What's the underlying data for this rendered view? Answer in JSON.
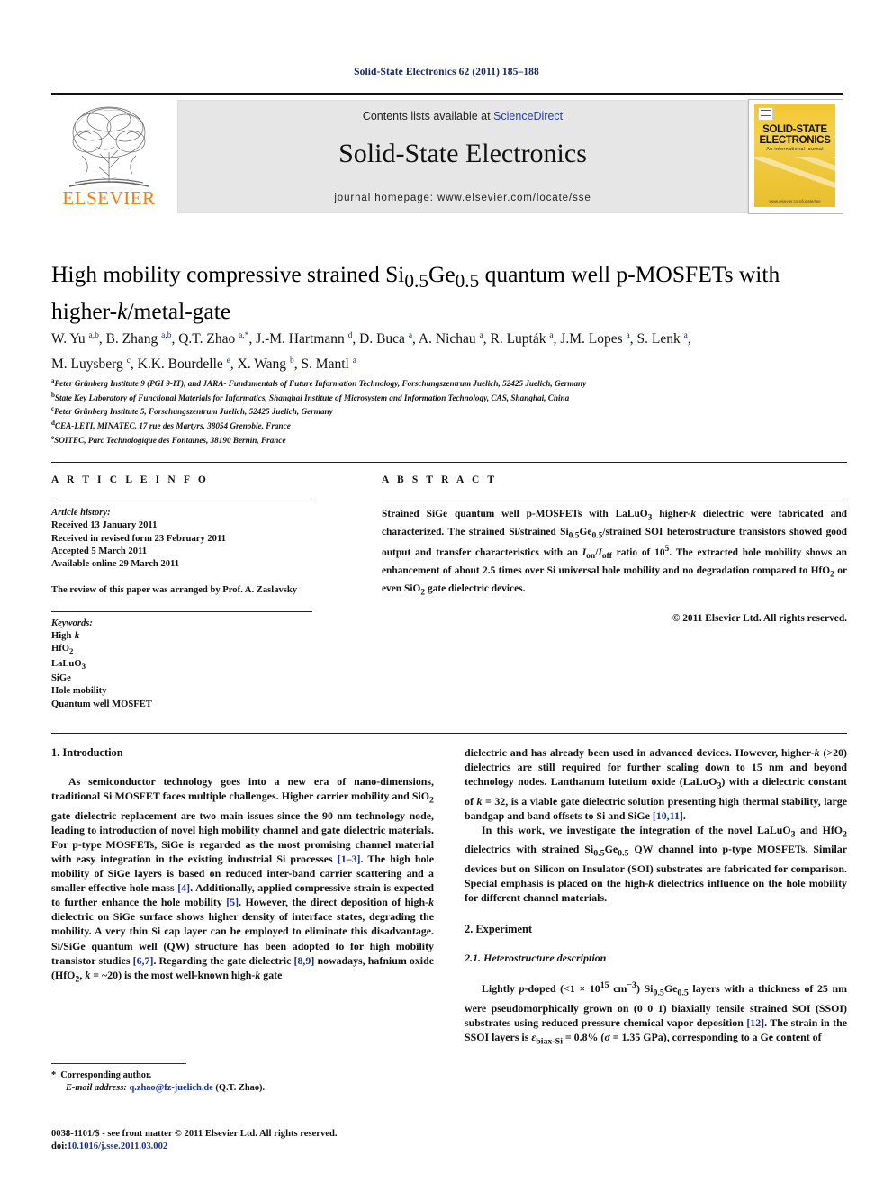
{
  "running_head": "Solid-State Electronics 62 (2011) 185–188",
  "masthead": {
    "contents_prefix": "Contents lists available at ",
    "sciencedirect": "ScienceDirect",
    "journal_title": "Solid-State Electronics",
    "homepage": "journal homepage: www.elsevier.com/locate/sse",
    "publisher": "ELSEVIER",
    "cover": {
      "name_line1": "SOLID-STATE",
      "name_line2": "ELECTRONICS",
      "subtitle": "An international journal",
      "footer": "www.elsevier.com/locate/sse"
    },
    "colors": {
      "link": "#2b3f9e",
      "publisher_orange": "#F07F13",
      "banner_gray": "#e6e6e6",
      "cover_gold": "#f2c733"
    }
  },
  "article": {
    "title_part1": "High mobility compressive strained Si",
    "title_sub1": "0.5",
    "title_part2": "Ge",
    "title_sub2": "0.5",
    "title_part3": " quantum well p-MOSFETs with higher-",
    "title_italic_k": "k",
    "title_part4": "/metal-gate",
    "authors_line1": "W. Yu a,b, B. Zhang a,b, Q.T. Zhao a,*, J.-M. Hartmann d, D. Buca a, A. Nichau a, R. Lupták a, J.M. Lopes a, S. Lenk a,",
    "authors_line2": "M. Luysberg c, K.K. Bourdelle e, X. Wang b, S. Mantl a",
    "affiliations": [
      {
        "mark": "a",
        "text": "Peter Grünberg Institute 9 (PGI 9-IT), and JARA- Fundamentals of Future Information Technology, Forschungszentrum Juelich, 52425 Juelich, Germany"
      },
      {
        "mark": "b",
        "text": "State Key Laboratory of Functional Materials for Informatics, Shanghai Institute of Microsystem and Information Technology, CAS, Shanghai, China"
      },
      {
        "mark": "c",
        "text": "Peter Grünberg Institute 5, Forschungszentrum Juelich, 52425 Juelich, Germany"
      },
      {
        "mark": "d",
        "text": "CEA-LETI, MINATEC, 17 rue des Martyrs, 38054 Grenoble, France"
      },
      {
        "mark": "e",
        "text": "SOITEC, Parc Technologique des Fontaines, 38190 Bernin, France"
      }
    ]
  },
  "article_info": {
    "heading": "A R T I C L E   I N F O",
    "history_label": "Article history:",
    "history": [
      "Received 13 January 2011",
      "Received in revised form 23 February 2011",
      "Accepted 5 March 2011",
      "Available online 29 March 2011"
    ],
    "review_note": "The review of this paper was arranged by Prof. A. Zaslavsky",
    "keywords_label": "Keywords:",
    "keywords": [
      "High-k",
      "HfO2",
      "LaLuO3",
      "SiGe",
      "Hole mobility",
      "Quantum well MOSFET"
    ]
  },
  "abstract": {
    "heading": "A B S T R A C T",
    "text": "Strained SiGe quantum well p-MOSFETs with LaLuO3 higher-k dielectric were fabricated and characterized. The strained Si/strained Si0.5Ge0.5/strained SOI heterostructure transistors showed good output and transfer characteristics with an Ion/Ioff ratio of 105. The extracted hole mobility shows an enhancement of about 2.5 times over Si universal hole mobility and no degradation compared to HfO2 or even SiO2 gate dielectric devices.",
    "copyright": "© 2011 Elsevier Ltd. All rights reserved."
  },
  "body": {
    "section1_heading": "1. Introduction",
    "intro_p1": "As semiconductor technology goes into a new era of nano-dimensions, traditional Si MOSFET faces multiple challenges. Higher carrier mobility and SiO2 gate dielectric replacement are two main issues since the 90 nm technology node, leading to introduction of novel high mobility channel and gate dielectric materials. For p-type MOSFETs, SiGe is regarded as the most promising channel material with easy integration in the existing industrial Si processes [1–3]. The high hole mobility of SiGe layers is based on reduced inter-band carrier scattering and a smaller effective hole mass [4]. Additionally, applied compressive strain is expected to further enhance the hole mobility [5]. However, the direct deposition of high-k dielectric on SiGe surface shows higher density of interface states, degrading the mobility. A very thin Si cap layer can be employed to eliminate this disadvantage. Si/SiGe quantum well (QW) structure has been adopted to for high mobility transistor studies [6,7]. Regarding the gate dielectric [8,9] nowadays, hafnium oxide (HfO2, k = ~20) is the most well-known high-k gate",
    "intro_p1_cont": "dielectric and has already been used in advanced devices. However, higher-k (>20) dielectrics are still required for further scaling down to 15 nm and beyond technology nodes. Lanthanum lutetium oxide (LaLuO3) with a dielectric constant of k = 32, is a viable gate dielectric solution presenting high thermal stability, large bandgap and band offsets to Si and SiGe [10,11].",
    "intro_p2": "In this work, we investigate the integration of the novel LaLuO3 and HfO2 dielectrics with strained Si0.5Ge0.5 QW channel into p-type MOSFETs. Similar devices but on Silicon on Insulator (SOI) substrates are fabricated for comparison. Special emphasis is placed on the high-k dielectrics influence on the hole mobility for different channel materials.",
    "section2_heading": "2. Experiment",
    "section21_heading": "2.1. Heterostructure description",
    "exp_p1": "Lightly p-doped (<1 × 1015 cm−3) Si0.5Ge0.5 layers with a thickness of 25 nm were pseudomorphically grown on (0 0 1) biaxially tensile strained SOI (SSOI) substrates using reduced pressure chemical vapor deposition [12]. The strain in the SSOI layers is εbiax-Si = 0.8% (σ = 1.35 GPa), corresponding to a Ge content of"
  },
  "footnote": {
    "corresponding": "Corresponding author.",
    "email_label": "E-mail address:",
    "email": "q.zhao@fz-juelich.de",
    "email_owner": "(Q.T. Zhao)."
  },
  "footer": {
    "issn_line": "0038-1101/$ - see front matter © 2011 Elsevier Ltd. All rights reserved.",
    "doi_label": "doi:",
    "doi": "10.1016/j.sse.2011.03.002"
  }
}
